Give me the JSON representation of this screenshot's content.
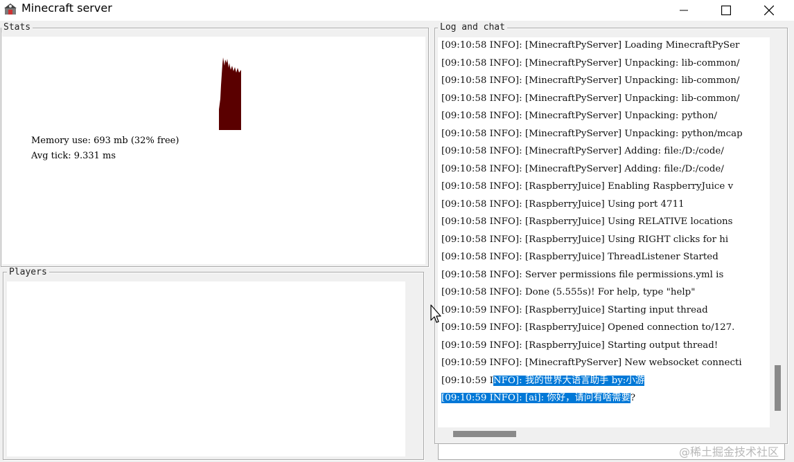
{
  "window": {
    "title": "Minecraft server",
    "icon": "minecraft-server-icon"
  },
  "stats": {
    "label": "Stats",
    "memory_line": "Memory use: 693 mb (32% free)",
    "tick_line": "Avg tick: 9.331 ms",
    "graph_color": "#5a0000"
  },
  "players": {
    "label": "Players"
  },
  "log": {
    "label": "Log and chat",
    "lines": [
      "[09:10:58 INFO]: [MinecraftPyServer] Loading MinecraftPySer",
      "[09:10:58 INFO]: [MinecraftPyServer] Unpacking: lib-common/",
      "[09:10:58 INFO]: [MinecraftPyServer] Unpacking: lib-common/",
      "[09:10:58 INFO]: [MinecraftPyServer] Unpacking: lib-common/",
      "[09:10:58 INFO]: [MinecraftPyServer] Unpacking: python/",
      "[09:10:58 INFO]: [MinecraftPyServer] Unpacking: python/mcap",
      "[09:10:58 INFO]: [MinecraftPyServer] Adding: file:/D:/code/",
      "[09:10:58 INFO]: [MinecraftPyServer] Adding: file:/D:/code/",
      "[09:10:58 INFO]: [RaspberryJuice] Enabling RaspberryJuice v",
      "[09:10:58 INFO]: [RaspberryJuice] Using port 4711",
      "[09:10:58 INFO]: [RaspberryJuice] Using RELATIVE locations",
      "[09:10:58 INFO]: [RaspberryJuice] Using RIGHT clicks for hi",
      "[09:10:58 INFO]: [RaspberryJuice] ThreadListener Started",
      "[09:10:58 INFO]: Server permissions file permissions.yml is",
      "[09:10:58 INFO]: Done (5.555s)! For help, type \"help\"",
      "[09:10:59 INFO]: [RaspberryJuice] Starting input thread",
      "[09:10:59 INFO]: [RaspberryJuice] Opened connection to/127.",
      "[09:10:59 INFO]: [RaspberryJuice] Starting output thread!",
      "[09:10:59 INFO]: [MinecraftPyServer] New websocket connecti"
    ],
    "selected_lines": [
      {
        "pre": "[09:10:59 I",
        "sel": "NFO]:  我的世界大语言助手 by:小游",
        "post": ""
      },
      {
        "pre": "",
        "sel": "[09:10:59 INFO]:  [ai]: 你好，请问有啥需要",
        "post": "?"
      }
    ],
    "selection_color": "#0078d7"
  },
  "chat_input": {
    "value": ""
  },
  "watermark": "@稀土掘金技术社区"
}
